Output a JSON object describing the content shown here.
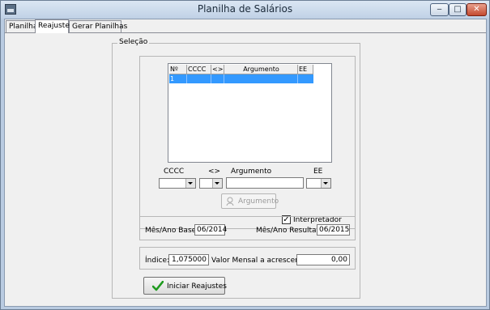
{
  "window": {
    "title": "Planilha de Salários",
    "minimize": "‒",
    "maximize": "□",
    "close": "✕"
  },
  "tabs": [
    {
      "label": "Planilha"
    },
    {
      "label": "Reajuste"
    },
    {
      "label": "Gerar Planilhas"
    }
  ],
  "group": {
    "label": "Seleção"
  },
  "grid": {
    "columns": [
      "Nº",
      "CCCC",
      "<>",
      "Argumento",
      "EE"
    ],
    "rows": [
      {
        "n": "1",
        "cccc": "",
        "op": "",
        "argumento": "",
        "ee": ""
      }
    ]
  },
  "filters": {
    "cccc_label": "CCCC",
    "op_label": "<>",
    "argumento_label": "Argumento",
    "ee_label": "EE"
  },
  "argumento_button": "Argumento",
  "interpretador": {
    "label": "Interpretador",
    "checked": "✓"
  },
  "base": {
    "base_label": "Mês/Ano Base:",
    "base_value": "06/2014",
    "resultado_label": "Mês/Ano Resultado:",
    "resultado_value": "06/2015"
  },
  "indice": {
    "indice_label": "Índice:",
    "indice_value": "1,075000",
    "valor_label": "Valor Mensal a acrescentar:",
    "valor_value": "0,00"
  },
  "start_button": "Iniciar Reajustes",
  "colors": {
    "selection": "#3399ff",
    "check_green": "#1e9a1e"
  }
}
